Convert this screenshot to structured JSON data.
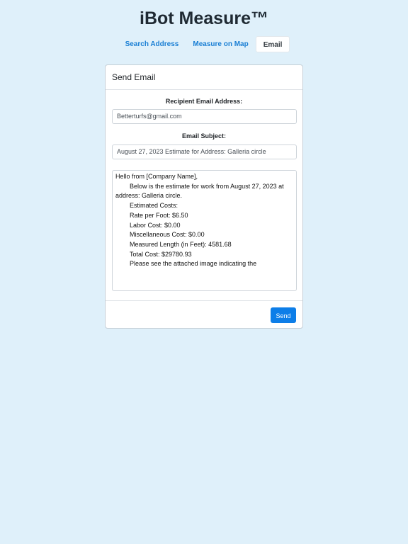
{
  "app": {
    "title": "iBot Measure™"
  },
  "tabs": [
    {
      "label": "Search Address",
      "active": false
    },
    {
      "label": "Measure on Map",
      "active": false
    },
    {
      "label": "Email",
      "active": true
    }
  ],
  "email_card": {
    "header": "Send Email",
    "recipient_label": "Recipient Email Address:",
    "recipient_value": "Betterturfs@gmail.com",
    "subject_label": "Email Subject:",
    "subject_value": "August 27, 2023 Estimate for Address: Galleria circle",
    "body_lines": [
      "Hello from [Company Name],",
      "",
      "        Below is the estimate for work from August 27, 2023 at address: Galleria circle.",
      "",
      "        Estimated Costs:",
      "        Rate per Foot: $6.50",
      "        Labor Cost: $0.00",
      "        Miscellaneous Cost: $0.00",
      "        Measured Length (in Feet): 4581.68",
      "        Total Cost: $29780.93",
      "",
      "        Please see the attached image indicating the"
    ],
    "send_label": "Send"
  },
  "colors": {
    "background": "#dff0fa",
    "tab_link": "#1a7fd4",
    "send_button": "#0d7ee8"
  }
}
